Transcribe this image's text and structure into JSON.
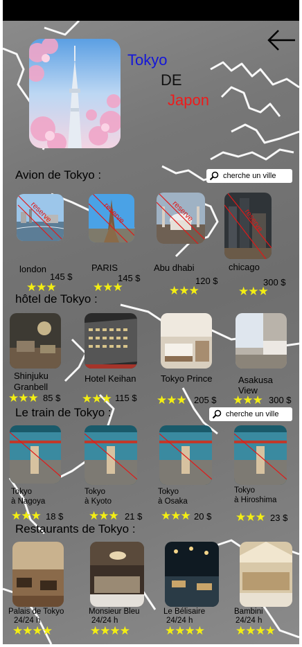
{
  "header": {
    "title_line1": "Tokyo",
    "title_line2": "DE",
    "title_line3": "Japon",
    "back_icon": "arrow-left-icon"
  },
  "colors": {
    "title_blue": "#1416d8",
    "title_red": "#ee1b1b",
    "star": "#f3ee13",
    "reserve_stamp": "#e01818"
  },
  "flights": {
    "title": "Avion de Tokyo :",
    "search_placeholder": "cherche un ville",
    "stamp": "reserve",
    "items": [
      {
        "name": "london",
        "price": "145 $",
        "stars": "★★★"
      },
      {
        "name": "PARIS",
        "price": "145 $",
        "stars": "★★★"
      },
      {
        "name": "Abu dhabi",
        "price": "120 $",
        "stars": "★★★"
      },
      {
        "name": "chicago",
        "price": "300 $",
        "stars": "★★★"
      }
    ]
  },
  "hotels": {
    "title": "hôtel de Tokyo :",
    "items": [
      {
        "name_line1": "Shinjuku",
        "name_line2": "Granbell",
        "price": "85 $",
        "stars": "★★★"
      },
      {
        "name_line1": "Hotel Keihan",
        "name_line2": "",
        "price": "115 $",
        "stars": "★★★"
      },
      {
        "name_line1": "Tokyo Prince",
        "name_line2": "",
        "price": "205 $",
        "stars": "★★★"
      },
      {
        "name_line1": "Asakusa",
        "name_line2": "View",
        "price": "300 $",
        "stars": "★★★"
      }
    ]
  },
  "trains": {
    "title": "Le train de Tokyo :",
    "search_placeholder": "cherche un ville",
    "items": [
      {
        "name_line1": "Tokyo",
        "name_line2": "à Nagoya",
        "price": "18 $",
        "stars": "★★★"
      },
      {
        "name_line1": "Tokyo",
        "name_line2": "à Kyoto",
        "price": "21 $",
        "stars": "★★★"
      },
      {
        "name_line1": "Tokyo",
        "name_line2": "à Osaka",
        "price": "20 $",
        "stars": "★★★"
      },
      {
        "name_line1": "Tokyo",
        "name_line2": "à Hiroshima",
        "price": "23 $",
        "stars": "★★★"
      }
    ]
  },
  "restaurants": {
    "title": "Restaurants de Tokyo :",
    "items": [
      {
        "name": "Palais de Tokyo",
        "hours": "24/24 h",
        "stars": "★★★★"
      },
      {
        "name": "Monsieur Bleu",
        "hours": "24/24 h",
        "stars": "★★★★"
      },
      {
        "name": "Le Bélisaire",
        "hours": "24/24 h",
        "stars": "★★★★"
      },
      {
        "name": "Bambini",
        "hours": "24/24 h",
        "stars": "★★★★"
      }
    ]
  }
}
